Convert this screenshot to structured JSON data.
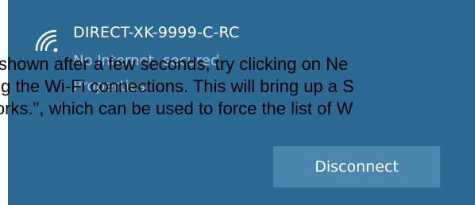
{
  "network": {
    "name": "DIRECT-XK-9999-C-RC",
    "status": "No Internet, secured",
    "properties_label": "Properties",
    "icon": "wifi-signal-icon"
  },
  "actions": {
    "disconnect_label": "Disconnect"
  },
  "overlay_text": {
    "line1": "is shown after a few seconds, try clicking on Ne",
    "line2": "ing the Wi-Fi connections. This will bring up a S",
    "line3": "works.\", which can be used to force the list of W"
  },
  "colors": {
    "panel_background": "#2c6a94",
    "button_background": "#4a86ad",
    "secondary_text": "#a9c3d6"
  }
}
